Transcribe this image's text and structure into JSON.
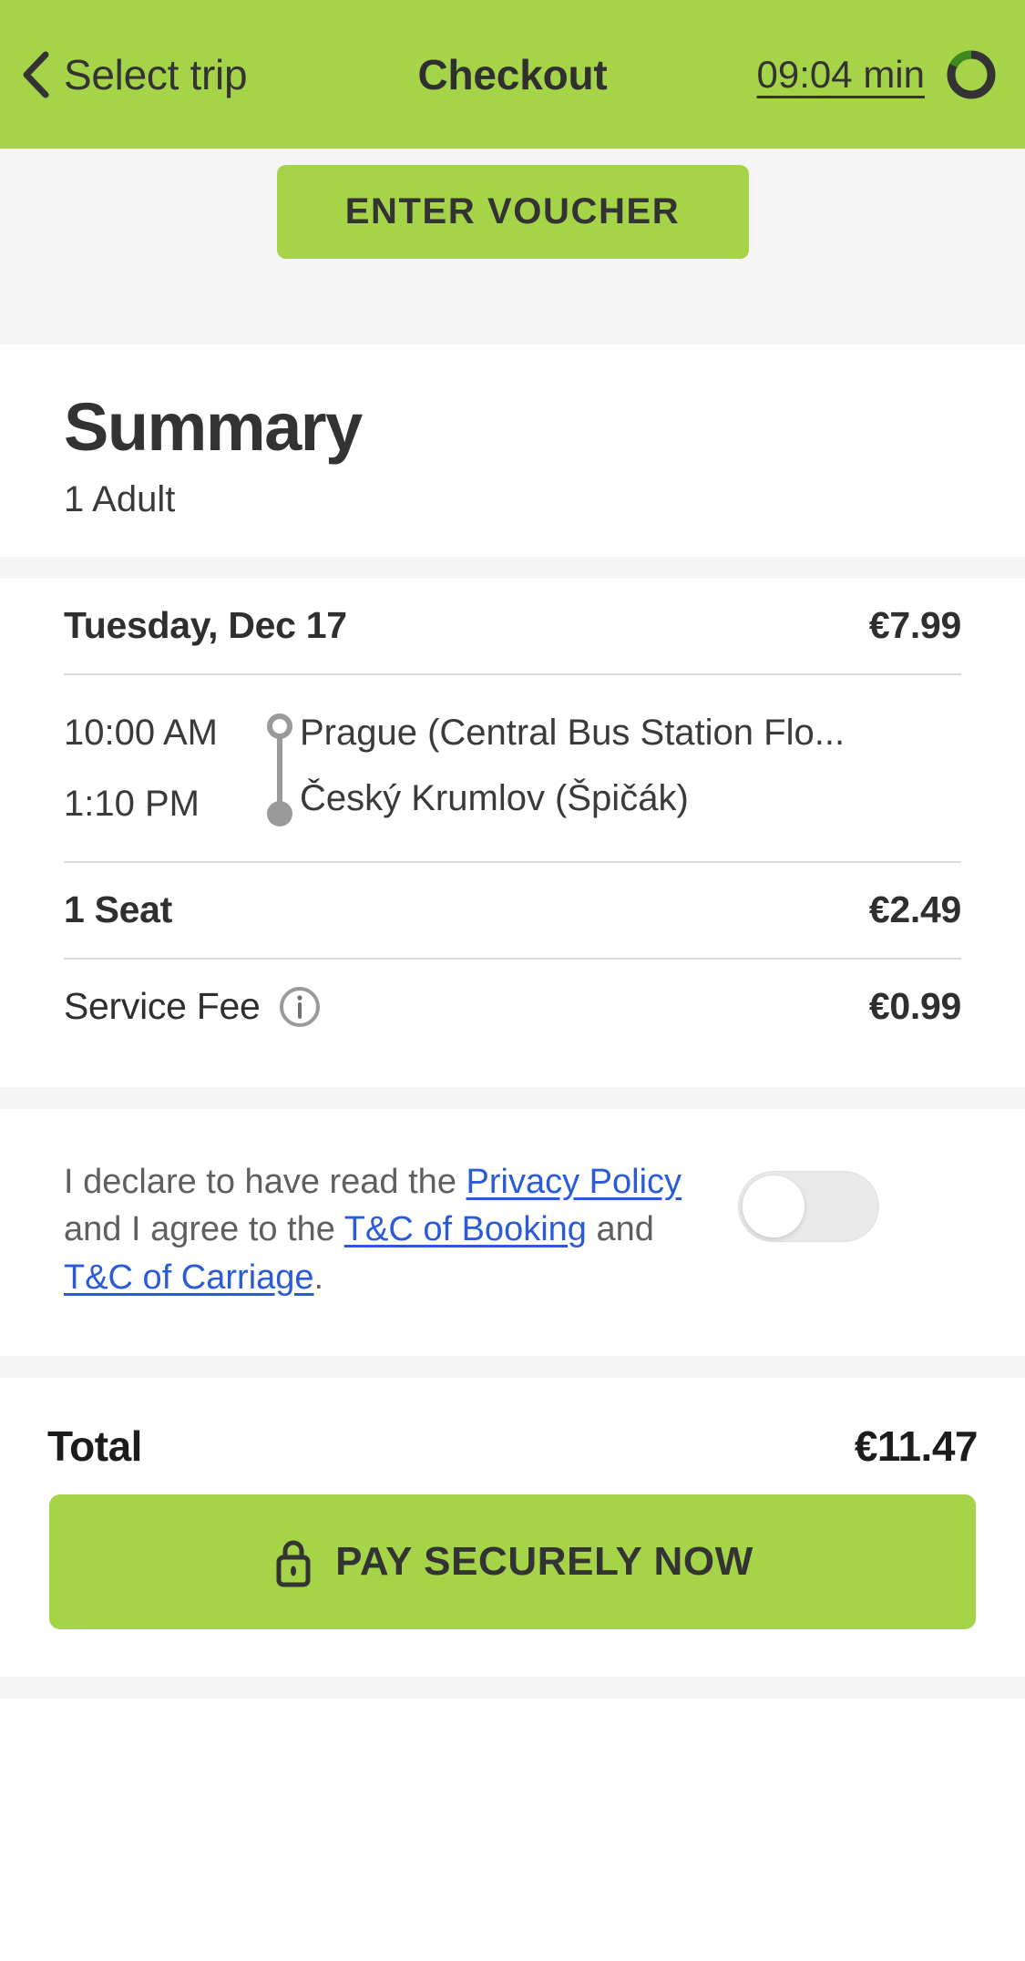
{
  "header": {
    "back_label": "Select trip",
    "back_icon": "chevron-left-icon",
    "title": "Checkout",
    "timer_text": "09:04 min",
    "timer_icon": "timer-ring-icon",
    "bg_color": "#a6d449",
    "text_color": "#333333"
  },
  "voucher": {
    "label": "ENTER VOUCHER",
    "bg_color": "#a6d449"
  },
  "summary": {
    "title": "Summary",
    "passengers": "1 Adult"
  },
  "trip": {
    "date": "Tuesday, Dec 17",
    "date_price": "€7.99",
    "departure_time": "10:00 AM",
    "departure_stop": "Prague (Central Bus Station Flo...",
    "arrival_time": "1:10 PM",
    "arrival_stop": "Český Krumlov (Špičák)",
    "seat_label": "1 Seat",
    "seat_price": "€2.49",
    "fee_label": "Service Fee",
    "fee_info_icon": "info-circle-icon",
    "fee_price": "€0.99"
  },
  "declaration": {
    "part1": "I declare to have read the ",
    "link1": "Privacy Policy",
    "part2": " and I agree to the ",
    "link2": "T&C of Booking",
    "part3": " and ",
    "link3": "T&C of Carriage",
    "part4": ".",
    "toggle_state": "off",
    "link_color": "#2b5bd7"
  },
  "total": {
    "label": "Total",
    "value": "€11.47"
  },
  "pay": {
    "label": "PAY SECURELY NOW",
    "icon": "lock-icon",
    "bg_color": "#a6d449"
  }
}
